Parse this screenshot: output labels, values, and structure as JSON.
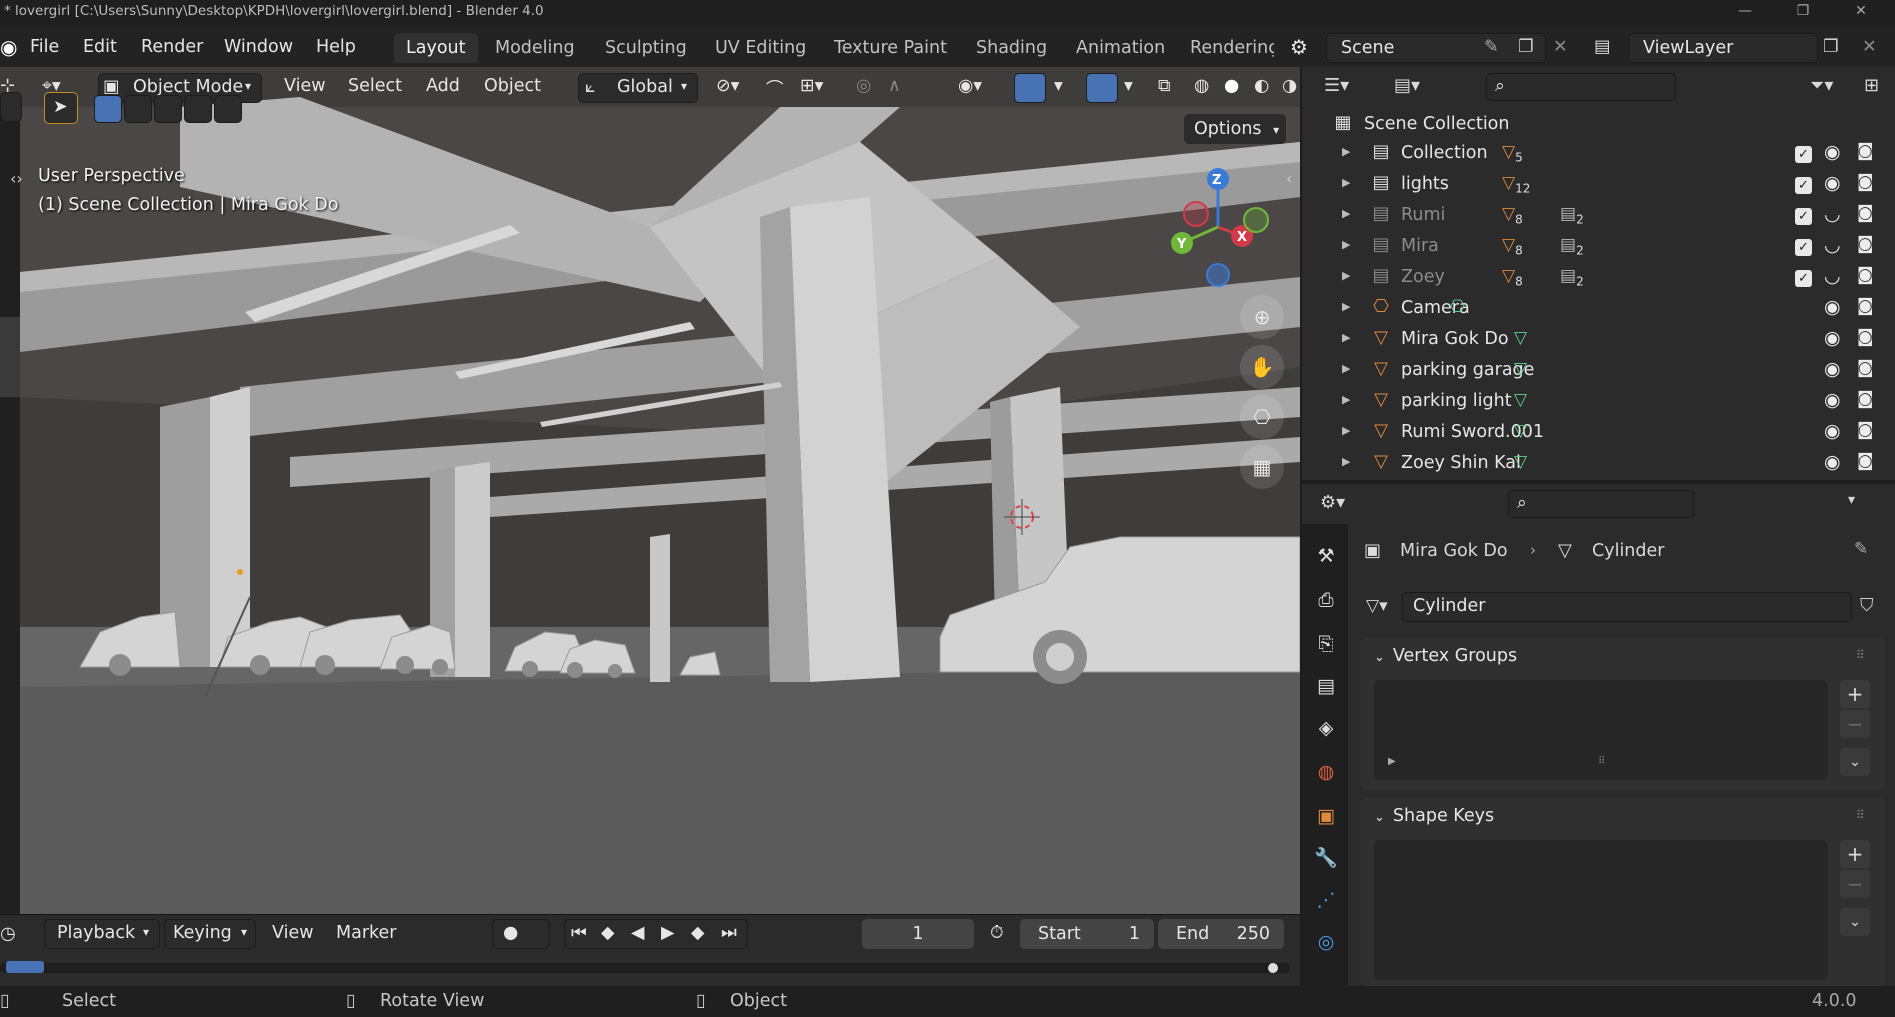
{
  "window": {
    "title": "* lovergirl [C:\\Users\\Sunny\\Desktop\\KPDH\\lovergirl\\lovergirl.blend] - Blender 4.0"
  },
  "menu": [
    "File",
    "Edit",
    "Render",
    "Window",
    "Help"
  ],
  "workspaces": [
    "Layout",
    "Modeling",
    "Sculpting",
    "UV Editing",
    "Texture Paint",
    "Shading",
    "Animation",
    "Renderinç"
  ],
  "scene": {
    "name": "Scene",
    "view_layer": "ViewLayer"
  },
  "viewport": {
    "mode": "Object Mode",
    "menus": [
      "View",
      "Select",
      "Add",
      "Object"
    ],
    "transform": "Global",
    "options_label": "Options",
    "perspective": "User Perspective",
    "collection_info": "(1) Scene Collection | Mira Gok Do",
    "gizmo_axes": {
      "z": "Z",
      "y": "Y",
      "x": "X"
    }
  },
  "timeline": {
    "menus": [
      "Playback",
      "Keying",
      "View",
      "Marker"
    ],
    "current_frame": "1",
    "start_label": "Start",
    "start_value": "1",
    "end_label": "End",
    "end_value": "250"
  },
  "status": {
    "select": "Select",
    "rotate": "Rotate View",
    "object": "Object",
    "version": "4.0.0"
  },
  "outliner": {
    "root": "Scene Collection",
    "items": [
      {
        "label": "Collection",
        "badge": "5",
        "checkbox": true,
        "dim": false
      },
      {
        "label": "lights",
        "badge": "12",
        "checkbox": true,
        "dim": false
      },
      {
        "label": "Rumi",
        "badge": "8",
        "badge2": "2",
        "checkbox": true,
        "dim": true
      },
      {
        "label": "Mira",
        "badge": "8",
        "badge2": "2",
        "checkbox": true,
        "dim": true
      },
      {
        "label": "Zoey",
        "badge": "8",
        "badge2": "2",
        "checkbox": true,
        "dim": true
      },
      {
        "label": "Camera",
        "checkbox": false,
        "dim": false
      },
      {
        "label": "Mira Gok Do",
        "checkbox": false,
        "dim": false
      },
      {
        "label": "parking garage",
        "checkbox": false,
        "dim": false
      },
      {
        "label": "parking light",
        "checkbox": false,
        "dim": false
      },
      {
        "label": "Rumi Sword.001",
        "checkbox": false,
        "dim": false
      },
      {
        "label": "Zoey Shin Kal",
        "checkbox": false,
        "dim": false
      }
    ]
  },
  "properties": {
    "breadcrumb_object": "Mira Gok Do",
    "breadcrumb_data": "Cylinder",
    "mesh_name": "Cylinder",
    "vertex_groups_title": "Vertex Groups",
    "shape_keys_title": "Shape Keys"
  },
  "colors": {
    "accent": "#4772b3",
    "object_orange": "#e08a3a",
    "mesh_green": "#5fd38a",
    "background": "#2b2b2b"
  }
}
